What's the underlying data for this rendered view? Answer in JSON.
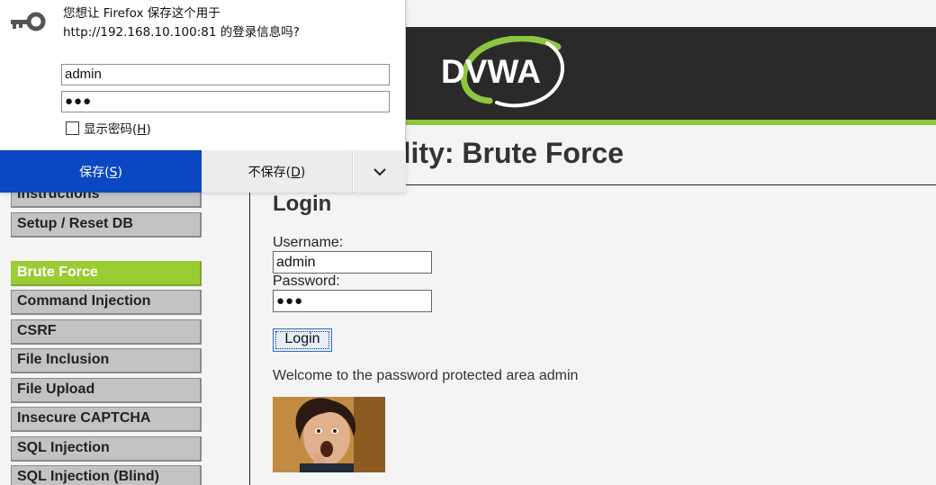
{
  "header": {
    "logo_text": "DVWA",
    "page_title": "Vulnerability: Brute Force"
  },
  "sidebar": {
    "items": [
      {
        "label": "Instructions",
        "selected": false
      },
      {
        "label": "Setup / Reset DB",
        "selected": false
      },
      {
        "label": "Brute Force",
        "selected": true
      },
      {
        "label": "Command Injection",
        "selected": false
      },
      {
        "label": "CSRF",
        "selected": false
      },
      {
        "label": "File Inclusion",
        "selected": false
      },
      {
        "label": "File Upload",
        "selected": false
      },
      {
        "label": "Insecure CAPTCHA",
        "selected": false
      },
      {
        "label": "SQL Injection",
        "selected": false
      },
      {
        "label": "SQL Injection (Blind)",
        "selected": false
      }
    ]
  },
  "main": {
    "login_title": "Login",
    "username_label": "Username:",
    "username_value": "admin",
    "password_label": "Password:",
    "password_value": "●●●",
    "login_button": "Login",
    "welcome_text": "Welcome to the password protected area admin"
  },
  "popup": {
    "message_line1": "您想让 Firefox 保存这个用于",
    "message_line2": "http://192.168.10.100:81 的登录信息吗?",
    "username_value": "admin",
    "password_value": "●●●",
    "show_password_label": "显示密码(",
    "show_password_key": "H",
    "save_label": "保存(",
    "save_key": "S",
    "dont_save_label": "不保存(",
    "dont_save_key": "D",
    "key_icon": "key-icon",
    "more_icon": "chevron-down-icon"
  },
  "colors": {
    "header_bg": "#2a2a2a",
    "accent_green": "#8dc63f",
    "selected_menu": "#9bcc34",
    "save_button": "#0a47c2"
  }
}
